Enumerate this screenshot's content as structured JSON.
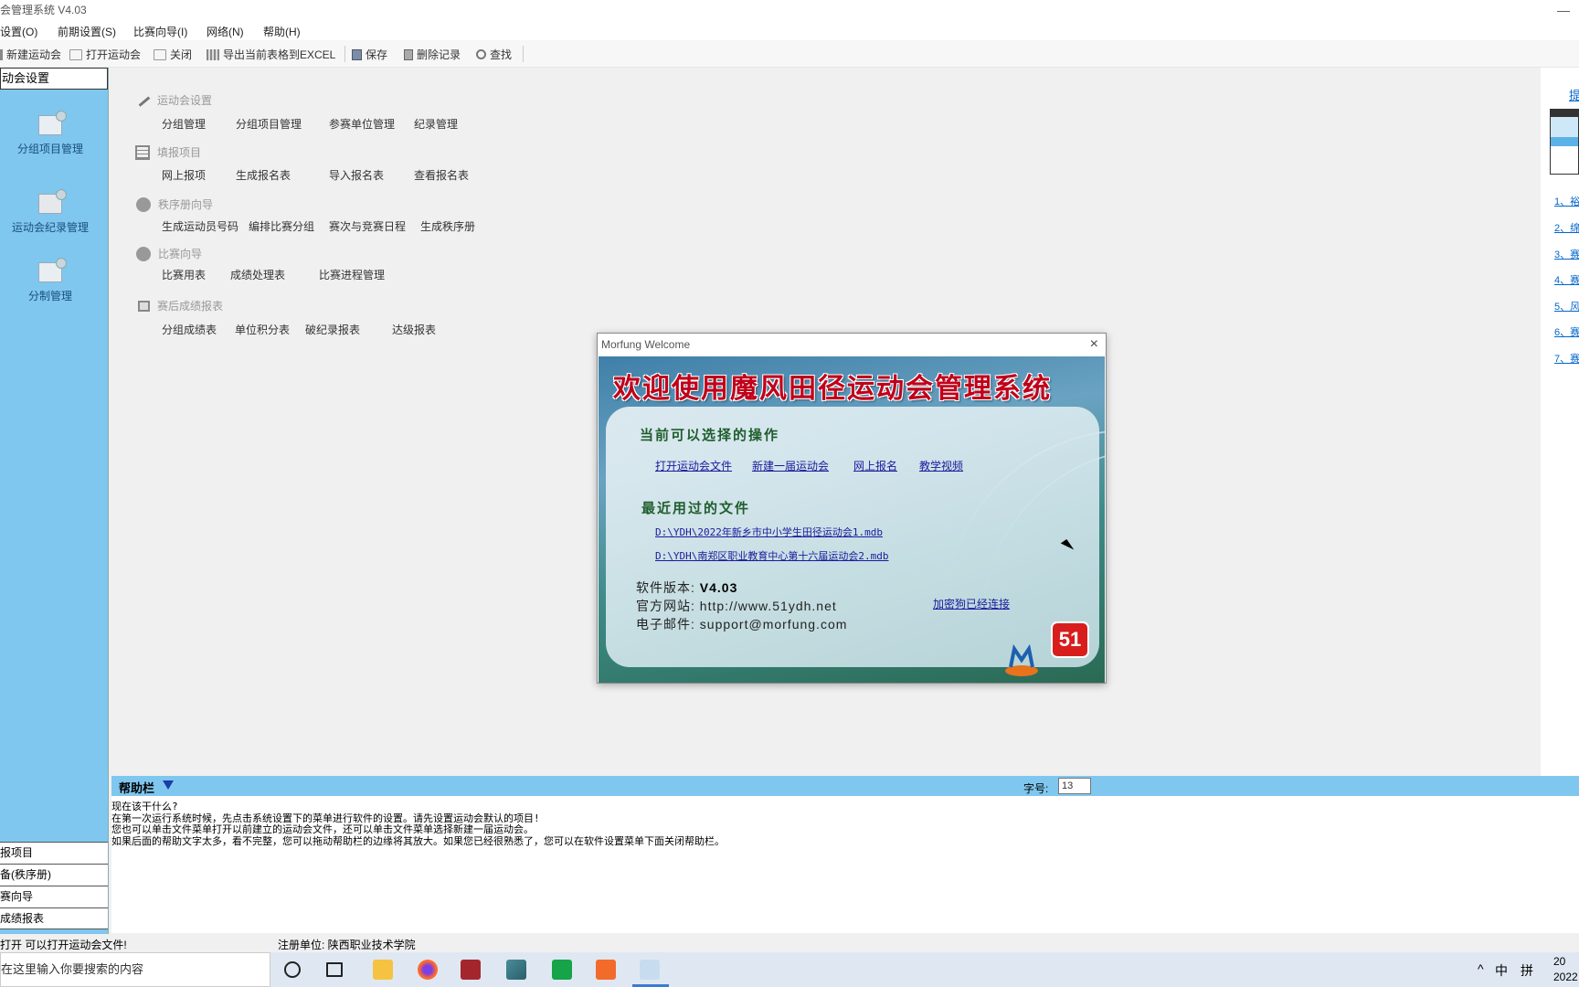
{
  "app": {
    "title": "会管理系统 V4.03",
    "minimize": "—"
  },
  "menu": [
    "设置(O)",
    "前期设置(S)",
    "比赛向导(I)",
    "网络(N)",
    "帮助(H)"
  ],
  "toolbar": {
    "new_meet": "新建运动会",
    "open_meet": "打开运动会",
    "close": "关闭",
    "export_excel": "导出当前表格到EXCEL",
    "save": "保存",
    "delete_record": "删除记录",
    "find": "查找"
  },
  "sidebar": {
    "header": "动会设置",
    "items": [
      "分组项目管理",
      "运动会纪录管理",
      "分制管理"
    ],
    "bottom_items": [
      "报项目",
      "备(秩序册)",
      "赛向导",
      "成绩报表"
    ]
  },
  "main": {
    "sections": [
      {
        "title": "运动会设置",
        "links": [
          "分组管理",
          "分组项目管理",
          "参赛单位管理",
          "纪录管理"
        ]
      },
      {
        "title": "填报项目",
        "links": [
          "网上报项",
          "生成报名表",
          "导入报名表",
          "查看报名表"
        ]
      },
      {
        "title": "秩序册向导",
        "links": [
          "生成运动员号码",
          "编排比赛分组",
          "赛次与竞赛日程",
          "生成秩序册"
        ]
      },
      {
        "title": "比赛向导",
        "links": [
          "比赛用表",
          "成绩处理表",
          "比赛进程管理"
        ]
      },
      {
        "title": "赛后成绩报表",
        "links": [
          "分组成绩表",
          "单位积分表",
          "破纪录报表",
          "达级报表"
        ]
      }
    ]
  },
  "right_panel": {
    "top_link": "提",
    "links": [
      "1、裕",
      "2、绵",
      "3、赛",
      "4、赛",
      "5、风",
      "6、赛",
      "7、赛"
    ]
  },
  "help": {
    "title": "帮助栏",
    "font_size_label": "字号:",
    "font_size_value": "13",
    "lines": [
      "现在该干什么?",
      "    在第一次运行系统时候，先点击系统设置下的菜单进行软件的设置。请先设置运动会默认的项目!",
      "    您也可以单击文件菜单打开以前建立的运动会文件，还可以单击文件菜单选择新建一届运动会。",
      "    如果后面的帮助文字太多，看不完整，您可以拖动帮助栏的边缘将其放大。如果您已经很熟悉了，您可以在软件设置菜单下面关闭帮助栏。"
    ]
  },
  "status": {
    "left": "打开 可以打开运动会文件!",
    "registered": "注册单位: 陕西职业技术学院"
  },
  "taskbar": {
    "search_placeholder": "在这里输入你要搜索的内容",
    "tray_chevron": "^",
    "tray_ime": "中",
    "tray_ime2": "拼",
    "clock_line1": "20",
    "clock_line2": "2022"
  },
  "dialog": {
    "window_title": "Morfung Welcome",
    "close": "×",
    "heading": "欢迎使用魔风田径运动会管理系统",
    "ops_title": "当前可以选择的操作",
    "ops": [
      "打开运动会文件",
      "新建一届运动会",
      "网上报名",
      "教学视频"
    ],
    "recent_title": "最近用过的文件",
    "recent_files": [
      "D:\\YDH\\2022年新乡市中小学生田径运动会1.mdb",
      "D:\\YDH\\南郑区职业教育中心第十六届运动会2.mdb"
    ],
    "version_label": "软件版本:",
    "version_value": "V4.03",
    "website_label": "官方网站:",
    "website_value": "http://www.51ydh.net",
    "email_label": "电子邮件:",
    "email_value": "support@morfung.com",
    "dongle_status": "加密狗已经连接",
    "logo51": "51"
  }
}
